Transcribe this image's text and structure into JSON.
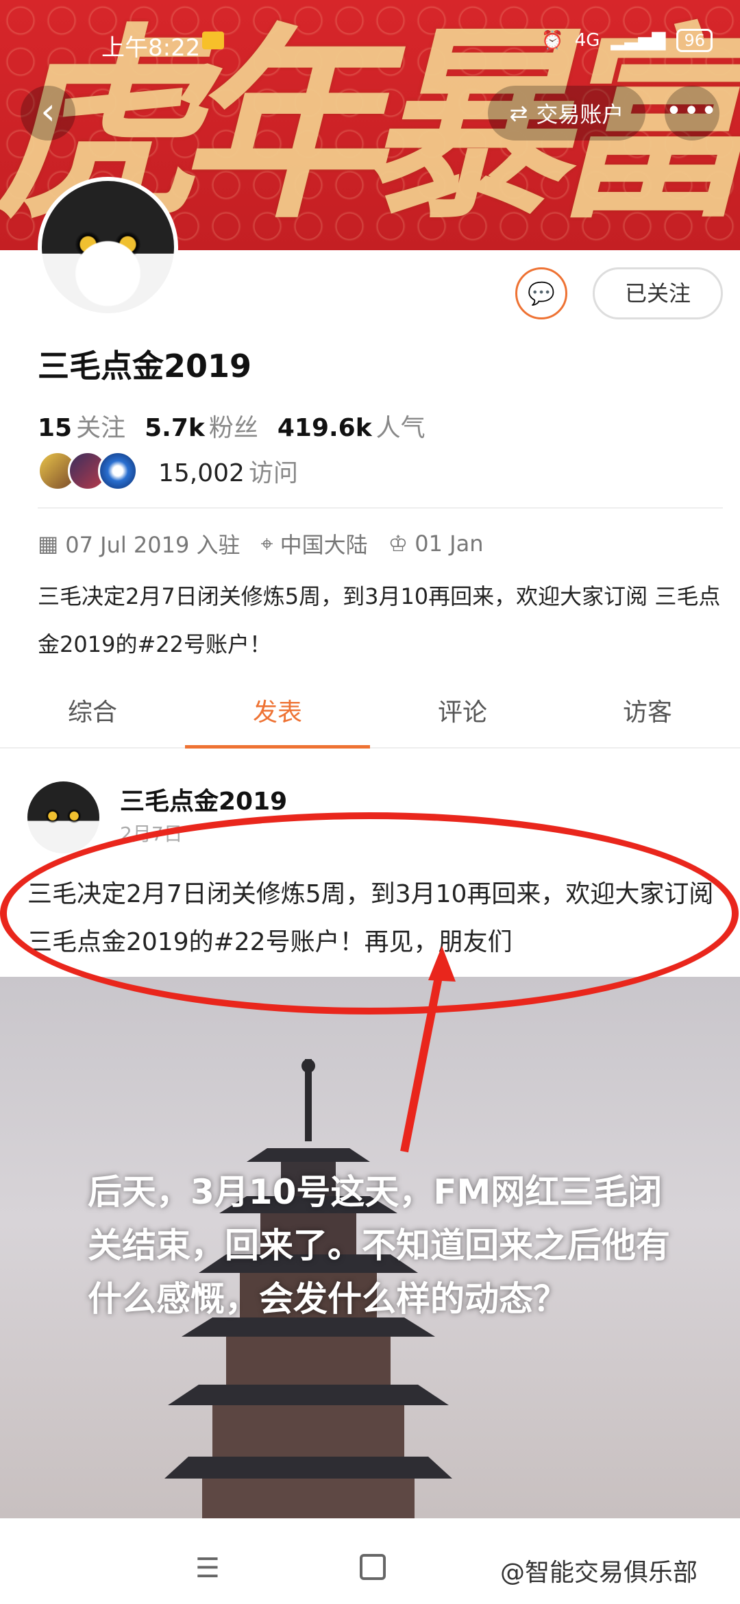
{
  "status": {
    "time": "上午8:22",
    "battery": "96",
    "network": "4G"
  },
  "banner": {
    "text": "虎年暴富"
  },
  "header": {
    "back_icon": "‹",
    "trade_label": "交易账户",
    "trade_icon": "⇄",
    "more_icon": "•••"
  },
  "profile": {
    "name": "三毛点金2019",
    "follow_label": "已关注",
    "chat_icon": "💬",
    "stats": {
      "following_count": "15",
      "following_label": "关注",
      "fans_count": "5.7k",
      "fans_label": "粉丝",
      "popularity_count": "419.6k",
      "popularity_label": "人气"
    },
    "visits": {
      "count": "15,002",
      "label": "访问"
    },
    "meta": {
      "joined": "07 Jul 2019 入驻",
      "location": "中国大陆",
      "birthday": "01 Jan"
    },
    "bio": "三毛决定2月7日闭关修炼5周，到3月10再回来，欢迎大家订阅 三毛点金2019的#22号账户！"
  },
  "tabs": [
    {
      "label": "综合"
    },
    {
      "label": "发表"
    },
    {
      "label": "评论"
    },
    {
      "label": "访客"
    }
  ],
  "post": {
    "author": "三毛点金2019",
    "date": "2月7日",
    "text": "三毛决定2月7日闭关修炼5周，到3月10再回来，欢迎大家订阅 三毛点金2019的#22号账户！再见，朋友们"
  },
  "annotation": {
    "text": "后天，3月10号这天，FM网红三毛闭关结束，回来了。不知道回来之后他有什么感慨，会发什么样的动态？",
    "color": "#e9261c"
  },
  "navbar": {
    "menu_icon": "☰",
    "watermark": "@智能交易俱乐部"
  },
  "colors": {
    "accent": "#ee7233",
    "banner_red": "#d7262a"
  }
}
